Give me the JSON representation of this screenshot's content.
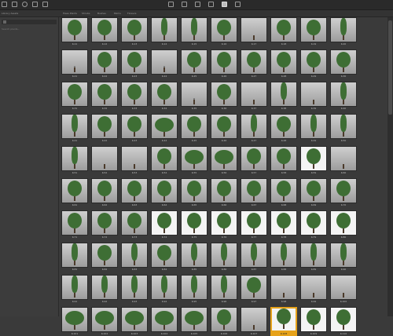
{
  "tabs": [
    "Library Assets",
    "Trees Plants",
    "Shrubs",
    "Bushes",
    "Palms",
    "Flowers"
  ],
  "search_placeholder": "Search plants...",
  "cells": [
    {
      "label": "K-11",
      "variant": "med"
    },
    {
      "label": "K-12",
      "variant": "med"
    },
    {
      "label": "K-13",
      "variant": "med"
    },
    {
      "label": "K-14",
      "variant": "slim"
    },
    {
      "label": "K-15",
      "variant": "slim"
    },
    {
      "label": "K-16",
      "variant": "med"
    },
    {
      "label": "K-17",
      "variant": "light"
    },
    {
      "label": "K-18",
      "variant": "med"
    },
    {
      "label": "K-19",
      "variant": "med"
    },
    {
      "label": "K-20",
      "variant": "slim"
    },
    {
      "label": "K-21",
      "variant": "bare"
    },
    {
      "label": "K-22",
      "variant": "med"
    },
    {
      "label": "K-23",
      "variant": "med"
    },
    {
      "label": "K-24",
      "variant": "bare"
    },
    {
      "label": "K-25",
      "variant": "med"
    },
    {
      "label": "K-26",
      "variant": "med"
    },
    {
      "label": "K-27",
      "variant": "med"
    },
    {
      "label": "K-28",
      "variant": "med"
    },
    {
      "label": "K-29",
      "variant": "med"
    },
    {
      "label": "K-30",
      "variant": "med"
    },
    {
      "label": "K-31",
      "variant": "med"
    },
    {
      "label": "K-32",
      "variant": "med"
    },
    {
      "label": "K-33",
      "variant": "med"
    },
    {
      "label": "K-34",
      "variant": "med"
    },
    {
      "label": "K-35",
      "variant": "bare"
    },
    {
      "label": "K-36",
      "variant": "med"
    },
    {
      "label": "K-37",
      "variant": "pale"
    },
    {
      "label": "K-38",
      "variant": "slim"
    },
    {
      "label": "K-39",
      "variant": "pale"
    },
    {
      "label": "K-40",
      "variant": "slim"
    },
    {
      "label": "K-41",
      "variant": "slim"
    },
    {
      "label": "K-42",
      "variant": "med"
    },
    {
      "label": "K-43",
      "variant": "med"
    },
    {
      "label": "K-44",
      "variant": "wide"
    },
    {
      "label": "K-45",
      "variant": "med"
    },
    {
      "label": "K-46",
      "variant": "med"
    },
    {
      "label": "K-47",
      "variant": "slim"
    },
    {
      "label": "K-48",
      "variant": "med"
    },
    {
      "label": "K-49",
      "variant": "slim"
    },
    {
      "label": "K-50",
      "variant": "slim"
    },
    {
      "label": "K-51",
      "variant": "slim"
    },
    {
      "label": "K-52",
      "variant": "light"
    },
    {
      "label": "K-53",
      "variant": "light"
    },
    {
      "label": "K-54",
      "variant": "med"
    },
    {
      "label": "K-55",
      "variant": "wide"
    },
    {
      "label": "K-56",
      "variant": "wide"
    },
    {
      "label": "K-57",
      "variant": "med"
    },
    {
      "label": "K-58",
      "variant": "med"
    },
    {
      "label": "K-59",
      "variant": "med",
      "thumb": "white"
    },
    {
      "label": "K-60",
      "variant": "light"
    },
    {
      "label": "K-61",
      "variant": "med"
    },
    {
      "label": "K-62",
      "variant": "med"
    },
    {
      "label": "K-63",
      "variant": "med"
    },
    {
      "label": "K-64",
      "variant": "med"
    },
    {
      "label": "K-65",
      "variant": "med"
    },
    {
      "label": "K-66",
      "variant": "med"
    },
    {
      "label": "K-67",
      "variant": "med"
    },
    {
      "label": "K-68",
      "variant": "med"
    },
    {
      "label": "K-69",
      "variant": "med"
    },
    {
      "label": "K-70",
      "variant": "med"
    },
    {
      "label": "K-71",
      "variant": "med"
    },
    {
      "label": "K-72",
      "variant": "med"
    },
    {
      "label": "K-73",
      "variant": "med"
    },
    {
      "label": "K-74",
      "variant": "med",
      "thumb": "white"
    },
    {
      "label": "K-75",
      "variant": "med",
      "thumb": "white"
    },
    {
      "label": "K-76",
      "variant": "med",
      "thumb": "white"
    },
    {
      "label": "K-77",
      "variant": "med",
      "thumb": "white"
    },
    {
      "label": "K-78",
      "variant": "med",
      "thumb": "white"
    },
    {
      "label": "K-79",
      "variant": "med",
      "thumb": "white"
    },
    {
      "label": "K-80",
      "variant": "med",
      "thumb": "white"
    },
    {
      "label": "K-81",
      "variant": "slim"
    },
    {
      "label": "K-82",
      "variant": "med"
    },
    {
      "label": "K-83",
      "variant": "slim"
    },
    {
      "label": "K-84",
      "variant": "med"
    },
    {
      "label": "K-85",
      "variant": "slim"
    },
    {
      "label": "K-86",
      "variant": "slim"
    },
    {
      "label": "K-87",
      "variant": "slim"
    },
    {
      "label": "K-88",
      "variant": "slim"
    },
    {
      "label": "K-89",
      "variant": "slim"
    },
    {
      "label": "K-90",
      "variant": "slim"
    },
    {
      "label": "K-91",
      "variant": "slim"
    },
    {
      "label": "K-92",
      "variant": "slim"
    },
    {
      "label": "K-93",
      "variant": "slim"
    },
    {
      "label": "K-94",
      "variant": "slim"
    },
    {
      "label": "K-95",
      "variant": "slim"
    },
    {
      "label": "K-96",
      "variant": "slim"
    },
    {
      "label": "K-97",
      "variant": "med"
    },
    {
      "label": "K-98",
      "variant": "pink"
    },
    {
      "label": "K-99",
      "variant": "pink"
    },
    {
      "label": "K-100",
      "variant": "pink"
    },
    {
      "label": "K-101",
      "variant": "wide"
    },
    {
      "label": "K-102",
      "variant": "wide"
    },
    {
      "label": "K-103",
      "variant": "wide"
    },
    {
      "label": "K-104",
      "variant": "wide"
    },
    {
      "label": "K-105",
      "variant": "wide"
    },
    {
      "label": "K-106",
      "variant": "med"
    },
    {
      "label": "K-107",
      "variant": "dark"
    },
    {
      "label": "K-108",
      "variant": "med",
      "thumb": "white",
      "selected": true
    },
    {
      "label": "K-109",
      "variant": "med",
      "thumb": "white"
    },
    {
      "label": "K-110",
      "variant": "med",
      "thumb": "white"
    }
  ]
}
